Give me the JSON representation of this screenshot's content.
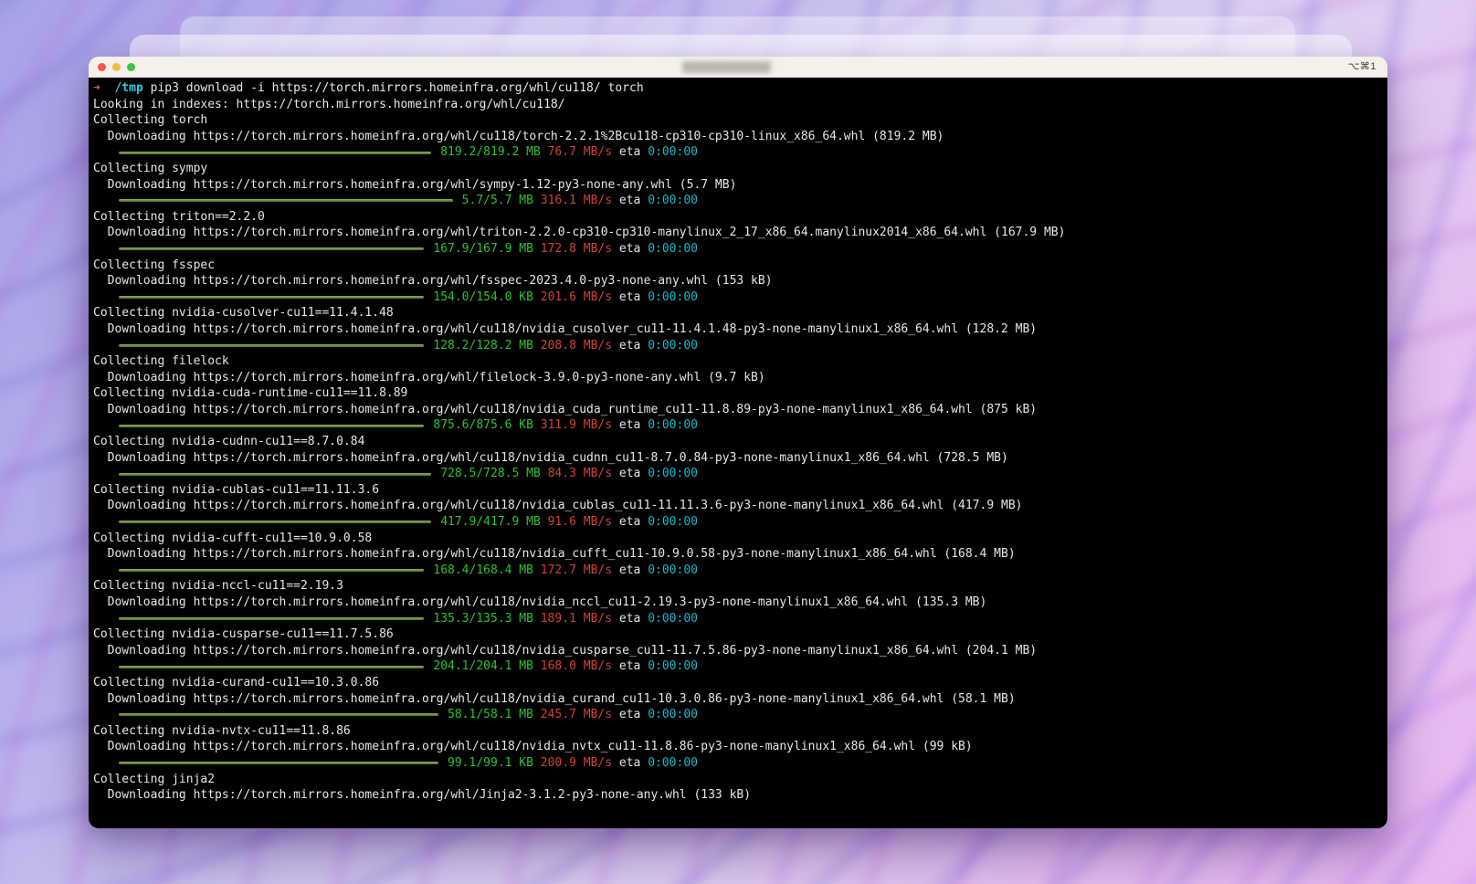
{
  "colors": {
    "term_background": "#000000",
    "term_foreground": "#e8e6e3",
    "green": "#2cc331",
    "red": "#cf4238",
    "cyan": "#14b8cd",
    "cwd_cyan": "#29cfe0",
    "arrow_red": "#e25c4f",
    "bar_green": "#678a38",
    "titlebar": "#f5f0ea",
    "light_red": "#f5564d",
    "light_yellow": "#f6bd3b",
    "light_green": "#34c748"
  },
  "window": {
    "shortcut_badge": "⌥⌘1"
  },
  "terminal": {
    "prompt": {
      "arrow": "➜",
      "cwd": "/tmp",
      "command": "pip3 download -i https://torch.mirrors.homeinfra.org/whl/cu118/ torch"
    },
    "lines": [
      {
        "type": "text",
        "text": "Looking in indexes: https://torch.mirrors.homeinfra.org/whl/cu118/"
      },
      {
        "type": "text",
        "text": "Collecting torch"
      },
      {
        "type": "text",
        "text": "  Downloading https://torch.mirrors.homeinfra.org/whl/cu118/torch-2.2.1%2Bcu118-cp310-cp310-linux_x86_64.whl (819.2 MB)"
      },
      {
        "type": "progress",
        "size": "819.2/819.2 MB",
        "speed": "76.7 MB/s",
        "eta_label": "eta",
        "eta": "0:00:00"
      },
      {
        "type": "text",
        "text": "Collecting sympy"
      },
      {
        "type": "text",
        "text": "  Downloading https://torch.mirrors.homeinfra.org/whl/sympy-1.12-py3-none-any.whl (5.7 MB)"
      },
      {
        "type": "progress",
        "size": "5.7/5.7 MB",
        "speed": "316.1 MB/s",
        "eta_label": "eta",
        "eta": "0:00:00"
      },
      {
        "type": "text",
        "text": "Collecting triton==2.2.0"
      },
      {
        "type": "text",
        "text": "  Downloading https://torch.mirrors.homeinfra.org/whl/triton-2.2.0-cp310-cp310-manylinux_2_17_x86_64.manylinux2014_x86_64.whl (167.9 MB)"
      },
      {
        "type": "progress",
        "size": "167.9/167.9 MB",
        "speed": "172.8 MB/s",
        "eta_label": "eta",
        "eta": "0:00:00"
      },
      {
        "type": "text",
        "text": "Collecting fsspec"
      },
      {
        "type": "text",
        "text": "  Downloading https://torch.mirrors.homeinfra.org/whl/fsspec-2023.4.0-py3-none-any.whl (153 kB)"
      },
      {
        "type": "progress",
        "size": "154.0/154.0 KB",
        "speed": "201.6 MB/s",
        "eta_label": "eta",
        "eta": "0:00:00"
      },
      {
        "type": "text",
        "text": "Collecting nvidia-cusolver-cu11==11.4.1.48"
      },
      {
        "type": "text",
        "text": "  Downloading https://torch.mirrors.homeinfra.org/whl/cu118/nvidia_cusolver_cu11-11.4.1.48-py3-none-manylinux1_x86_64.whl (128.2 MB)"
      },
      {
        "type": "progress",
        "size": "128.2/128.2 MB",
        "speed": "208.8 MB/s",
        "eta_label": "eta",
        "eta": "0:00:00"
      },
      {
        "type": "text",
        "text": "Collecting filelock"
      },
      {
        "type": "text",
        "text": "  Downloading https://torch.mirrors.homeinfra.org/whl/filelock-3.9.0-py3-none-any.whl (9.7 kB)"
      },
      {
        "type": "text",
        "text": "Collecting nvidia-cuda-runtime-cu11==11.8.89"
      },
      {
        "type": "text",
        "text": "  Downloading https://torch.mirrors.homeinfra.org/whl/cu118/nvidia_cuda_runtime_cu11-11.8.89-py3-none-manylinux1_x86_64.whl (875 kB)"
      },
      {
        "type": "progress",
        "size": "875.6/875.6 KB",
        "speed": "311.9 MB/s",
        "eta_label": "eta",
        "eta": "0:00:00"
      },
      {
        "type": "text",
        "text": "Collecting nvidia-cudnn-cu11==8.7.0.84"
      },
      {
        "type": "text",
        "text": "  Downloading https://torch.mirrors.homeinfra.org/whl/cu118/nvidia_cudnn_cu11-8.7.0.84-py3-none-manylinux1_x86_64.whl (728.5 MB)"
      },
      {
        "type": "progress",
        "size": "728.5/728.5 MB",
        "speed": "84.3 MB/s",
        "eta_label": "eta",
        "eta": "0:00:00"
      },
      {
        "type": "text",
        "text": "Collecting nvidia-cublas-cu11==11.11.3.6"
      },
      {
        "type": "text",
        "text": "  Downloading https://torch.mirrors.homeinfra.org/whl/cu118/nvidia_cublas_cu11-11.11.3.6-py3-none-manylinux1_x86_64.whl (417.9 MB)"
      },
      {
        "type": "progress",
        "size": "417.9/417.9 MB",
        "speed": "91.6 MB/s",
        "eta_label": "eta",
        "eta": "0:00:00"
      },
      {
        "type": "text",
        "text": "Collecting nvidia-cufft-cu11==10.9.0.58"
      },
      {
        "type": "text",
        "text": "  Downloading https://torch.mirrors.homeinfra.org/whl/cu118/nvidia_cufft_cu11-10.9.0.58-py3-none-manylinux1_x86_64.whl (168.4 MB)"
      },
      {
        "type": "progress",
        "size": "168.4/168.4 MB",
        "speed": "172.7 MB/s",
        "eta_label": "eta",
        "eta": "0:00:00"
      },
      {
        "type": "text",
        "text": "Collecting nvidia-nccl-cu11==2.19.3"
      },
      {
        "type": "text",
        "text": "  Downloading https://torch.mirrors.homeinfra.org/whl/cu118/nvidia_nccl_cu11-2.19.3-py3-none-manylinux1_x86_64.whl (135.3 MB)"
      },
      {
        "type": "progress",
        "size": "135.3/135.3 MB",
        "speed": "189.1 MB/s",
        "eta_label": "eta",
        "eta": "0:00:00"
      },
      {
        "type": "text",
        "text": "Collecting nvidia-cusparse-cu11==11.7.5.86"
      },
      {
        "type": "text",
        "text": "  Downloading https://torch.mirrors.homeinfra.org/whl/cu118/nvidia_cusparse_cu11-11.7.5.86-py3-none-manylinux1_x86_64.whl (204.1 MB)"
      },
      {
        "type": "progress",
        "size": "204.1/204.1 MB",
        "speed": "168.0 MB/s",
        "eta_label": "eta",
        "eta": "0:00:00"
      },
      {
        "type": "text",
        "text": "Collecting nvidia-curand-cu11==10.3.0.86"
      },
      {
        "type": "text",
        "text": "  Downloading https://torch.mirrors.homeinfra.org/whl/cu118/nvidia_curand_cu11-10.3.0.86-py3-none-manylinux1_x86_64.whl (58.1 MB)"
      },
      {
        "type": "progress",
        "size": "58.1/58.1 MB",
        "speed": "245.7 MB/s",
        "eta_label": "eta",
        "eta": "0:00:00"
      },
      {
        "type": "text",
        "text": "Collecting nvidia-nvtx-cu11==11.8.86"
      },
      {
        "type": "text",
        "text": "  Downloading https://torch.mirrors.homeinfra.org/whl/cu118/nvidia_nvtx_cu11-11.8.86-py3-none-manylinux1_x86_64.whl (99 kB)"
      },
      {
        "type": "progress",
        "size": "99.1/99.1 KB",
        "speed": "200.9 MB/s",
        "eta_label": "eta",
        "eta": "0:00:00"
      },
      {
        "type": "text",
        "text": "Collecting jinja2"
      },
      {
        "type": "text",
        "text": "  Downloading https://torch.mirrors.homeinfra.org/whl/Jinja2-3.1.2-py3-none-any.whl (133 kB)"
      }
    ]
  }
}
